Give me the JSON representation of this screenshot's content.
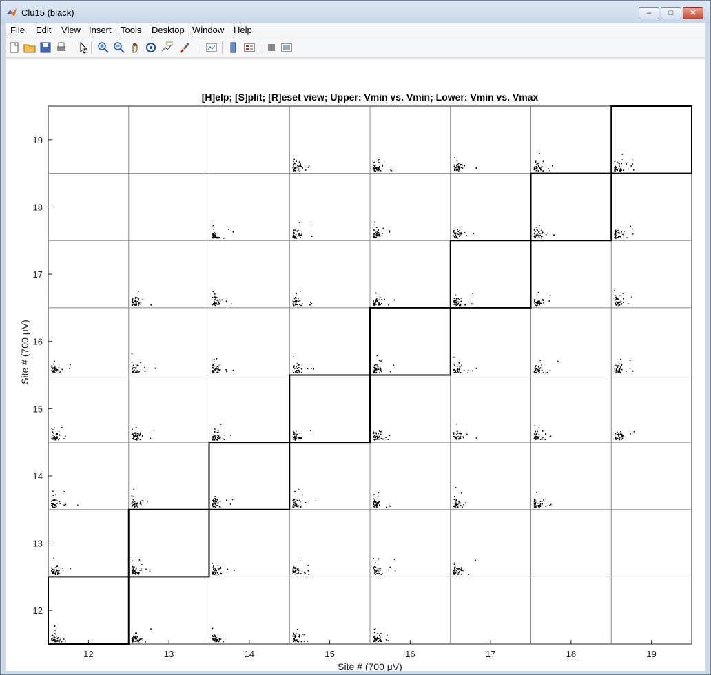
{
  "window": {
    "title": "Clu15 (black)",
    "minimize_label": "–",
    "maximize_label": "□",
    "close_label": "✕"
  },
  "menu": [
    {
      "label": "File",
      "u": "F",
      "rest": "ile"
    },
    {
      "label": "Edit",
      "u": "E",
      "rest": "dit"
    },
    {
      "label": "View",
      "u": "V",
      "rest": "iew"
    },
    {
      "label": "Insert",
      "u": "I",
      "rest": "nsert"
    },
    {
      "label": "Tools",
      "u": "T",
      "rest": "ools"
    },
    {
      "label": "Desktop",
      "u": "D",
      "rest": "esktop"
    },
    {
      "label": "Window",
      "u": "W",
      "rest": "indow"
    },
    {
      "label": "Help",
      "u": "H",
      "rest": "elp"
    }
  ],
  "toolbar_icons": [
    "new-figure-icon",
    "open-file-icon",
    "save-icon",
    "print-icon",
    "pointer-icon",
    "zoom-in-icon",
    "zoom-out-icon",
    "pan-icon",
    "rotate-icon",
    "data-cursor-icon",
    "brush-icon",
    "link-plot-icon",
    "colorbar-icon",
    "legend-icon",
    "hide-plot-tools-icon",
    "show-plot-tools-icon"
  ],
  "colors": {
    "highlight_box": "#000000",
    "grid": "#8c8c8c",
    "points": "#000000"
  },
  "chart_data": {
    "type": "scatter",
    "title": "[H]elp; [S]plit; [R]eset view; Upper: Vmin vs. Vmin; Lower: Vmin vs. Vmax",
    "xlabel": "Site # (700 μV)",
    "ylabel": "Site # (700 μV)",
    "xlim": [
      11.5,
      19.5
    ],
    "ylim": [
      11.5,
      19.5
    ],
    "xticks": [
      12,
      13,
      14,
      15,
      16,
      17,
      18,
      19
    ],
    "yticks": [
      12,
      13,
      14,
      15,
      16,
      17,
      18,
      19
    ],
    "grid": true,
    "highlighted_diagonal_sites": [
      12,
      13,
      14,
      15,
      16,
      17,
      18,
      19
    ],
    "note_cells": "scatter clusters present in each grid cell (x-site, y-site)",
    "clusters": [
      {
        "x": 12,
        "y": 12
      },
      {
        "x": 13,
        "y": 12
      },
      {
        "x": 14,
        "y": 12
      },
      {
        "x": 15,
        "y": 12
      },
      {
        "x": 16,
        "y": 12
      },
      {
        "x": 12,
        "y": 13
      },
      {
        "x": 13,
        "y": 13
      },
      {
        "x": 14,
        "y": 13
      },
      {
        "x": 15,
        "y": 13
      },
      {
        "x": 16,
        "y": 13
      },
      {
        "x": 17,
        "y": 13
      },
      {
        "x": 12,
        "y": 14
      },
      {
        "x": 13,
        "y": 14
      },
      {
        "x": 14,
        "y": 14
      },
      {
        "x": 15,
        "y": 14
      },
      {
        "x": 16,
        "y": 14
      },
      {
        "x": 17,
        "y": 14
      },
      {
        "x": 18,
        "y": 14
      },
      {
        "x": 12,
        "y": 15
      },
      {
        "x": 13,
        "y": 15
      },
      {
        "x": 14,
        "y": 15
      },
      {
        "x": 15,
        "y": 15
      },
      {
        "x": 16,
        "y": 15
      },
      {
        "x": 17,
        "y": 15
      },
      {
        "x": 18,
        "y": 15
      },
      {
        "x": 19,
        "y": 15
      },
      {
        "x": 12,
        "y": 16
      },
      {
        "x": 13,
        "y": 16
      },
      {
        "x": 14,
        "y": 16
      },
      {
        "x": 15,
        "y": 16
      },
      {
        "x": 16,
        "y": 16
      },
      {
        "x": 17,
        "y": 16
      },
      {
        "x": 18,
        "y": 16
      },
      {
        "x": 19,
        "y": 16
      },
      {
        "x": 13,
        "y": 17
      },
      {
        "x": 14,
        "y": 17
      },
      {
        "x": 15,
        "y": 17
      },
      {
        "x": 16,
        "y": 17
      },
      {
        "x": 17,
        "y": 17
      },
      {
        "x": 18,
        "y": 17
      },
      {
        "x": 19,
        "y": 17
      },
      {
        "x": 14,
        "y": 18
      },
      {
        "x": 15,
        "y": 18
      },
      {
        "x": 16,
        "y": 18
      },
      {
        "x": 17,
        "y": 18
      },
      {
        "x": 18,
        "y": 18
      },
      {
        "x": 19,
        "y": 18
      },
      {
        "x": 15,
        "y": 19
      },
      {
        "x": 16,
        "y": 19
      },
      {
        "x": 17,
        "y": 19
      },
      {
        "x": 18,
        "y": 19
      },
      {
        "x": 19,
        "y": 19
      }
    ]
  }
}
